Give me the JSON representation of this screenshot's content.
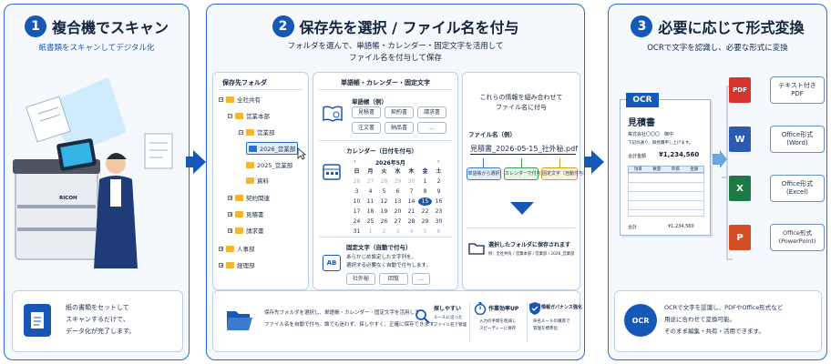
{
  "step1": {
    "number": "1",
    "title": "複合機でスキャン",
    "subtitle": "紙書類をスキャンしてデジタル化",
    "printer_brand": "RICOH",
    "note_lines": [
      "紙の書類をセットして",
      "スキャンするだけで、",
      "データ化が完了します。"
    ]
  },
  "step2": {
    "number": "2",
    "title": "保存先を選択 / ファイル名を付与",
    "subtitle_lines": [
      "フォルダを選んで、単語帳・カレンダー・固定文字を活用して",
      "ファイル名を付与して保存"
    ],
    "folder_panel": {
      "title": "保存先フォルダ",
      "items": [
        "全社共有",
        "営業本部",
        "営業部",
        "2026_営業部",
        "2025_営業部",
        "資料",
        "契約関連",
        "見積書",
        "請求書",
        "人事部",
        "経理部"
      ]
    },
    "middle_panel": {
      "title": "単語帳・カレンダー・固定文字",
      "wordbook_label": "単語帳（例）",
      "wordbook_tags": [
        "見積書",
        "契約書",
        "請求書",
        "注文書",
        "納品書",
        "…"
      ],
      "calendar_label": "カレンダー（日付を付与）",
      "calendar_month": "2026年5月",
      "calendar_prev": "‹",
      "calendar_next": "›",
      "weekdays": [
        "日",
        "月",
        "火",
        "水",
        "木",
        "金",
        "土"
      ],
      "days": [
        "26",
        "27",
        "28",
        "29",
        "30",
        "1",
        "2",
        "3",
        "4",
        "5",
        "6",
        "7",
        "8",
        "9",
        "10",
        "11",
        "12",
        "13",
        "14",
        "15",
        "16",
        "17",
        "18",
        "19",
        "20",
        "21",
        "22",
        "23",
        "24",
        "25",
        "26",
        "27",
        "28",
        "29",
        "30",
        "31",
        "1",
        "2",
        "3",
        "4",
        "5",
        "6"
      ],
      "fixed_label": "固定文字（自動で付与）",
      "fixed_desc_lines": [
        "あらかじめ設定した文字列を、",
        "選択する必要なく自動で付与します。"
      ],
      "fixed_tags": [
        "社外秘",
        "回覧",
        "…"
      ]
    },
    "right_panel": {
      "desc_lines": [
        "これらの情報を組み合わせて",
        "ファイル名に付与"
      ],
      "filename_label": "ファイル名（例）",
      "filename": "見積書_2026-05-15_社外秘.pdf",
      "flow_labels": [
        "単語帳から選択",
        "カレンダーで付与",
        "固定文字（自動付与）"
      ],
      "saved_text": "選択したフォルダに保存されます",
      "saved_path": "例：全社共有 / 営業本部 / 営業部 / 2026_営業部"
    },
    "bottom": {
      "desc_lines": [
        "保存先フォルダを選択し、単語帳・カレンダー・固定文字を活用して",
        "ファイル名を自動で付与。誰でも迷わず、探しやすく、正確に保存できます。"
      ],
      "benefits": [
        {
          "title": "探しやすい",
          "lines": [
            "ルールに沿った",
            "ファイル名で管理"
          ]
        },
        {
          "title": "作業効率UP",
          "lines": [
            "入力の手間を削減し",
            "スピーディーに保存"
          ]
        },
        {
          "title": "情報ガバナンス強化",
          "lines": [
            "命名ルールの徹底で",
            "管理を標準化"
          ]
        }
      ]
    }
  },
  "step3": {
    "number": "3",
    "title": "必要に応じて形式変換",
    "subtitle": "OCRで文字を認識し、必要な形式に変換",
    "ocr_label": "OCR",
    "doc": {
      "title": "見積書",
      "company": "株式会社〇〇〇　御中",
      "line": "下記の通り、御見積申し上げます。",
      "total_label": "合計金額",
      "total_value": "¥1,234,560",
      "cols": [
        "項目",
        "数量",
        "単価",
        "金額"
      ],
      "footer_label": "合計",
      "footer_value": "¥1,234,560"
    },
    "formats": [
      {
        "icon": "PDF",
        "label": "テキスト付き\nPDF",
        "color": "#d8332c"
      },
      {
        "icon": "W",
        "label": "Office形式\n(Word)",
        "color": "#2a5bb0"
      },
      {
        "icon": "X",
        "label": "Office形式\n(Excel)",
        "color": "#1e7a45"
      },
      {
        "icon": "P",
        "label": "Office形式\n(PowerPoint)",
        "color": "#d34e24"
      }
    ],
    "note_lines": [
      "OCRで文字を認識し、PDFやOffice形式など",
      "用途に合わせて変換可能。",
      "そのまま編集・共有・活用できます。"
    ]
  }
}
